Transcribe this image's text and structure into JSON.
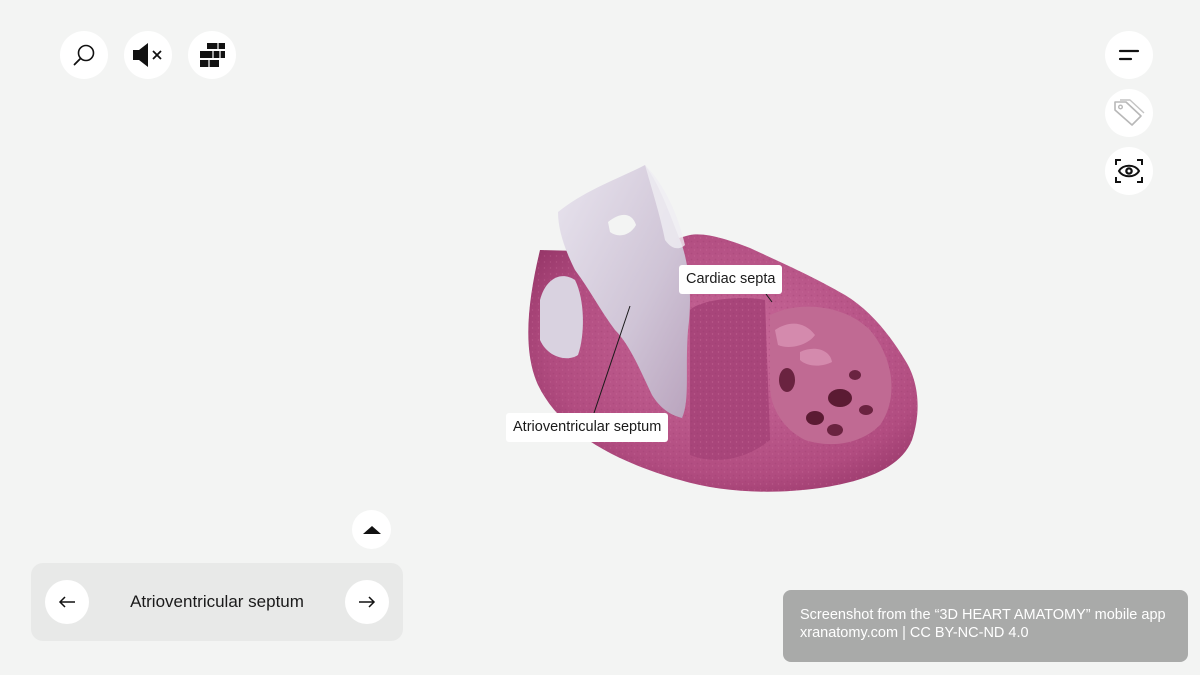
{
  "toolbar_left": {
    "search_icon": "search-icon",
    "mute_icon": "speaker-muted-icon",
    "layers_icon": "layers-icon"
  },
  "toolbar_right": {
    "menu_icon": "menu-lines-icon",
    "tag_icon": "tag-icon",
    "view_icon": "eye-focus-icon"
  },
  "model": {
    "labels": {
      "cardiac_septa": "Cardiac septa",
      "atrioventricular_septum": "Atrioventricular septum"
    },
    "colors": {
      "tissue": "#b85286",
      "tissue_dark": "#8f2f60",
      "membrane": "#dcd6e2",
      "cavity": "#5b1b33"
    }
  },
  "navigator": {
    "current_structure": "Atrioventricular septum",
    "prev_icon": "arrow-left-icon",
    "next_icon": "arrow-right-icon",
    "expand_icon": "caret-up-icon"
  },
  "credit": {
    "line1": "Screenshot from the “3D HEART AMATOMY” mobile app",
    "line2": "xranatomy.com | CC BY-NC-ND 4.0"
  }
}
